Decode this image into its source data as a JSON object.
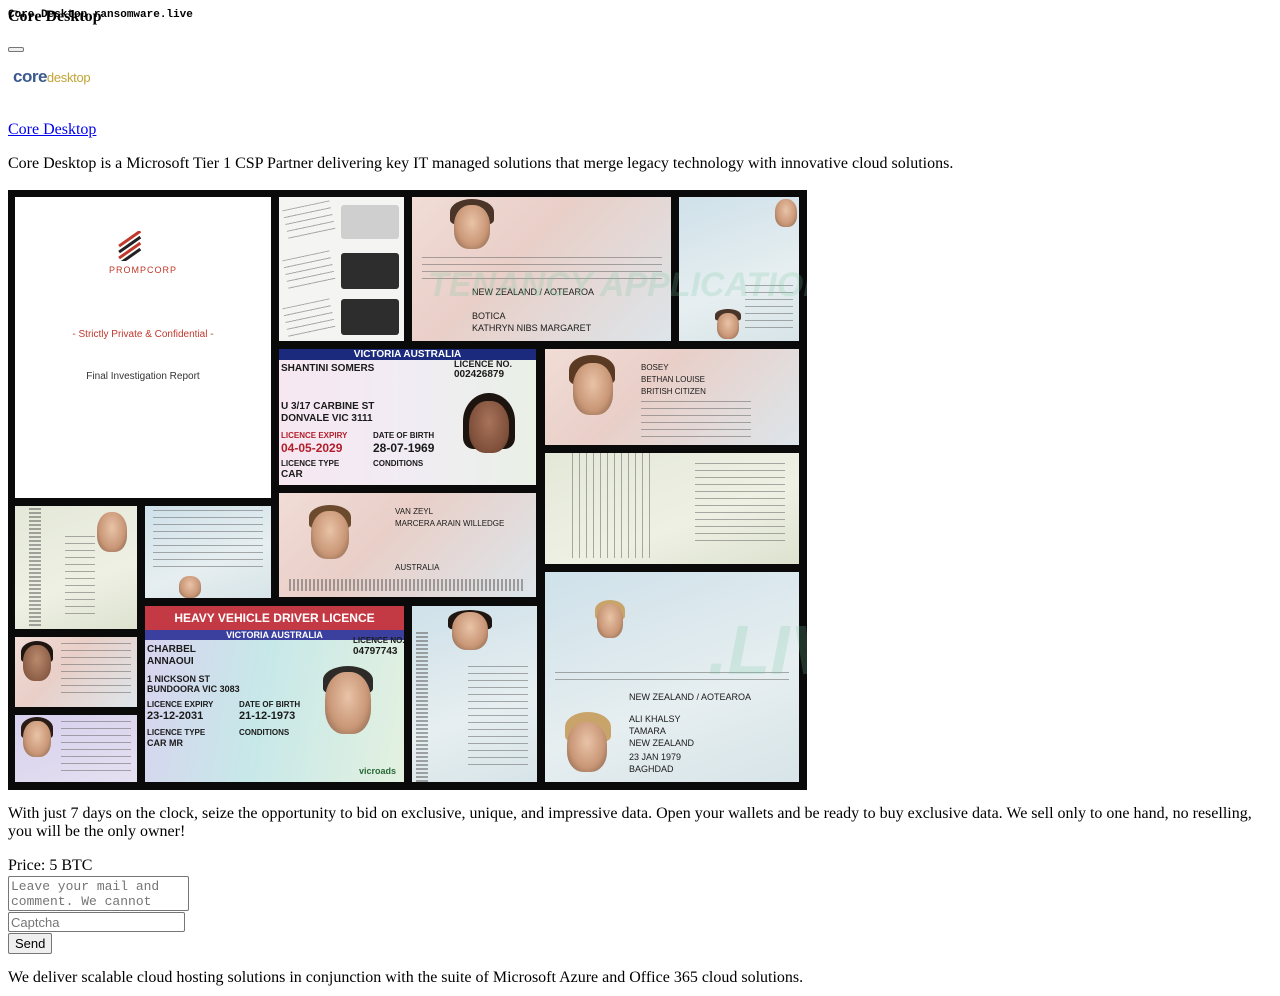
{
  "header": {
    "site_title": "Core Desktop",
    "overlay_title": "Core Desktop ransomware.live"
  },
  "logo": {
    "core": "core",
    "desktop": "desktop"
  },
  "company": {
    "name_link": "Core Desktop",
    "description": "Core Desktop is a Microsoft Tier 1 CSP Partner delivering key IT managed solutions that merge legacy technology with innovative cloud solutions."
  },
  "collage": {
    "cover_brand": "PROMPCORP",
    "cover_confidential": "- Strictly Private & Confidential -",
    "cover_report": "Final Investigation Report",
    "licence1_header": "VICTORIA AUSTRALIA",
    "licence1_name": "SHANTINI SOMERS",
    "licence1_address1": "U 3/17 CARBINE ST",
    "licence1_address2": "DONVALE VIC 3111",
    "licence1_no_label": "LICENCE NO.",
    "licence1_no": "002426879",
    "licence1_expiry_label": "LICENCE EXPIRY",
    "licence1_expiry": "04-05-2029",
    "licence1_dob_label": "DATE OF BIRTH",
    "licence1_dob": "28-07-1969",
    "licence1_type_label": "LICENCE TYPE",
    "licence1_type": "CAR",
    "licence1_conditions": "CONDITIONS",
    "licence2_title": "HEAVY VEHICLE DRIVER LICENCE",
    "licence2_header": "VICTORIA AUSTRALIA",
    "licence2_name1": "CHARBEL",
    "licence2_name2": "ANNAOUI",
    "licence2_address1": "1 NICKSON ST",
    "licence2_address2": "BUNDOORA VIC 3083",
    "licence2_no_label": "LICENCE NO.",
    "licence2_no": "04797743",
    "licence2_expiry_label": "LICENCE EXPIRY",
    "licence2_expiry": "23-12-2031",
    "licence2_dob_label": "DATE OF BIRTH",
    "licence2_dob": "21-12-1973",
    "licence2_type_label": "LICENCE TYPE",
    "licence2_type": "CAR MR",
    "licence2_conditions": "CONDITIONS",
    "licence2_issuer": "vicroads",
    "nz_passport_label": "NEW ZEALAND / AOTEAROA",
    "nz_surname": "BOTICA",
    "nz_given": "KATHRYN NIBS MARGARET",
    "nz2_surname": "ALI KHALSY",
    "nz2_given": "TAMARA",
    "nz2_country": "NEW ZEALAND",
    "nz2_dob": "23 JAN 1979",
    "nz2_place": "BAGHDAD",
    "uk_surname": "BOSEY",
    "uk_given": "BETHAN LOUISE",
    "uk_nationality": "BRITISH CITIZEN",
    "au_surname": "VAN ZEYL",
    "au_given": "MARCERA ARAIN WILLEDGE",
    "au_country": "AUSTRALIA",
    "watermark1": "TENANCY APPLICATION",
    "watermark2": ".LIVE"
  },
  "offer": {
    "text": "With just 7 days on the clock, seize the opportunity to bid on exclusive, unique, and impressive data. Open your wallets and be ready to buy exclusive data. We sell only to one hand, no reselling, you will be the only owner!",
    "price": "Price: 5 BTC"
  },
  "form": {
    "comment_placeholder": "Leave your mail and comment. We cannot",
    "captcha_placeholder": "Captcha",
    "send_label": "Send"
  },
  "footer": {
    "text": "We deliver scalable cloud hosting solutions in conjunction with the suite of Microsoft Azure and Office 365 cloud solutions."
  }
}
